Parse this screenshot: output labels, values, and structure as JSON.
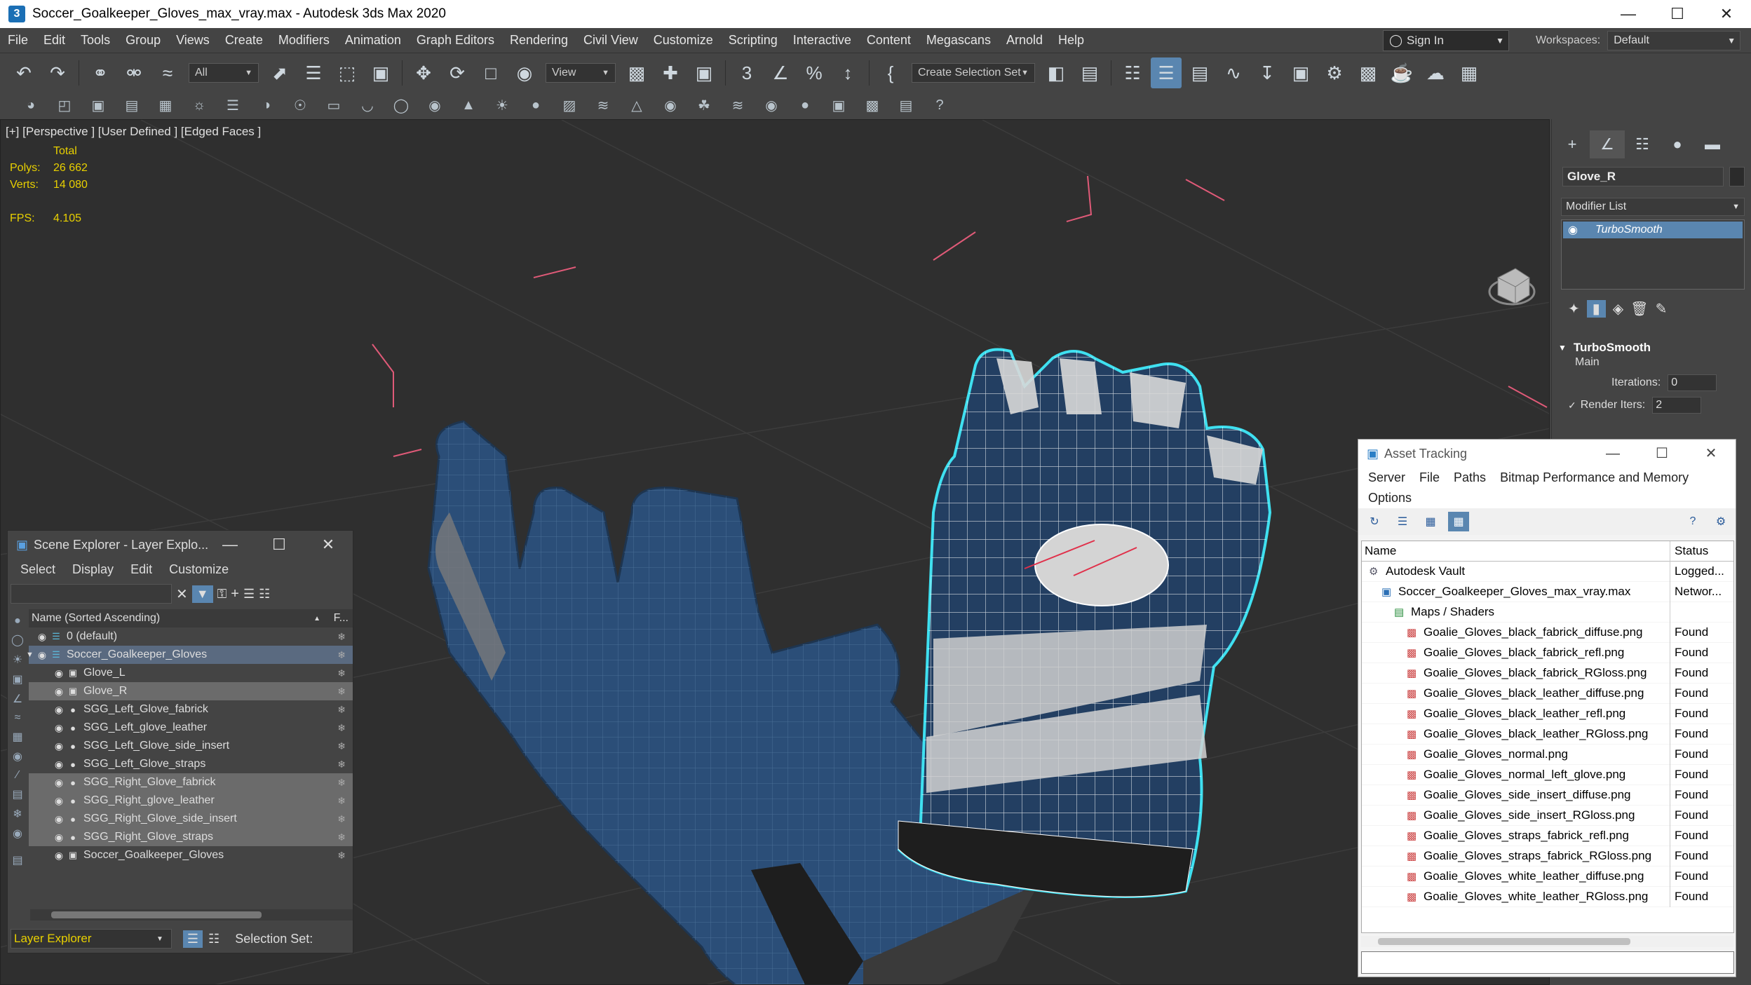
{
  "window": {
    "title": "Soccer_Goalkeeper_Gloves_max_vray.max - Autodesk 3ds Max 2020",
    "app_icon": "3"
  },
  "menu": [
    "File",
    "Edit",
    "Tools",
    "Group",
    "Views",
    "Create",
    "Modifiers",
    "Animation",
    "Graph Editors",
    "Rendering",
    "Civil View",
    "Customize",
    "Scripting",
    "Interactive",
    "Content",
    "Megascans",
    "Arnold",
    "Help"
  ],
  "signin": {
    "label": "Sign In"
  },
  "workspaces": {
    "label": "Workspaces:",
    "value": "Default"
  },
  "toolbar": {
    "filter_select": "All",
    "ref_coord": "View",
    "selection_set": "Create Selection Set"
  },
  "viewport": {
    "label": "[+] [Perspective ] [User Defined ] [Edged Faces ]",
    "stats_header": "Total",
    "polys_label": "Polys:",
    "polys": "26 662",
    "verts_label": "Verts:",
    "verts": "14 080",
    "fps_label": "FPS:",
    "fps": "4.105"
  },
  "command_panel": {
    "object_name": "Glove_R",
    "modifier_list": "Modifier List",
    "modifier_item": "TurboSmooth",
    "rollout_title": "TurboSmooth",
    "group": "Main",
    "iterations_label": "Iterations:",
    "iterations": "0",
    "render_iters_label": "Render Iters:",
    "render_iters": "2",
    "render_iters_checked": true
  },
  "scene_explorer": {
    "title": "Scene Explorer - Layer Explo...",
    "menu": [
      "Select",
      "Display",
      "Edit",
      "Customize"
    ],
    "col_name": "Name (Sorted Ascending)",
    "col_frozen": "F...",
    "rows": [
      {
        "label": "0 (default)",
        "level": 1,
        "type": "layer",
        "state": ""
      },
      {
        "label": "Soccer_Goalkeeper_Gloves",
        "level": 1,
        "type": "layer",
        "state": "hl"
      },
      {
        "label": "Glove_L",
        "level": 2,
        "type": "obj",
        "state": ""
      },
      {
        "label": "Glove_R",
        "level": 2,
        "type": "obj",
        "state": "sel"
      },
      {
        "label": "SGG_Left_Glove_fabrick",
        "level": 2,
        "type": "mat",
        "state": ""
      },
      {
        "label": "SGG_Left_glove_leather",
        "level": 2,
        "type": "mat",
        "state": ""
      },
      {
        "label": "SGG_Left_Glove_side_insert",
        "level": 2,
        "type": "mat",
        "state": ""
      },
      {
        "label": "SGG_Left_Glove_straps",
        "level": 2,
        "type": "mat",
        "state": ""
      },
      {
        "label": "SGG_Right_Glove_fabrick",
        "level": 2,
        "type": "mat",
        "state": "sel"
      },
      {
        "label": "SGG_Right_glove_leather",
        "level": 2,
        "type": "mat",
        "state": "sel"
      },
      {
        "label": "SGG_Right_Glove_side_insert",
        "level": 2,
        "type": "mat",
        "state": "sel"
      },
      {
        "label": "SGG_Right_Glove_straps",
        "level": 2,
        "type": "mat",
        "state": "sel"
      },
      {
        "label": "Soccer_Goalkeeper_Gloves",
        "level": 2,
        "type": "obj",
        "state": ""
      }
    ],
    "layer_dropdown": "Layer Explorer",
    "selection_set_label": "Selection Set:"
  },
  "asset_tracking": {
    "title": "Asset Tracking",
    "menu": [
      "Server",
      "File",
      "Paths",
      "Bitmap Performance and Memory",
      "Options"
    ],
    "col_name": "Name",
    "col_status": "Status",
    "rows": [
      {
        "name": "Autodesk Vault",
        "status": "Logged...",
        "indent": 0,
        "icon": "vault"
      },
      {
        "name": "Soccer_Goalkeeper_Gloves_max_vray.max",
        "status": "Networ...",
        "indent": 1,
        "icon": "max"
      },
      {
        "name": "Maps / Shaders",
        "status": "",
        "indent": 2,
        "icon": "folder"
      },
      {
        "name": "Goalie_Gloves_black_fabrick_diffuse.png",
        "status": "Found",
        "indent": 3,
        "icon": "file"
      },
      {
        "name": "Goalie_Gloves_black_fabrick_refl.png",
        "status": "Found",
        "indent": 3,
        "icon": "file"
      },
      {
        "name": "Goalie_Gloves_black_fabrick_RGloss.png",
        "status": "Found",
        "indent": 3,
        "icon": "file"
      },
      {
        "name": "Goalie_Gloves_black_leather_diffuse.png",
        "status": "Found",
        "indent": 3,
        "icon": "file"
      },
      {
        "name": "Goalie_Gloves_black_leather_refl.png",
        "status": "Found",
        "indent": 3,
        "icon": "file"
      },
      {
        "name": "Goalie_Gloves_black_leather_RGloss.png",
        "status": "Found",
        "indent": 3,
        "icon": "file"
      },
      {
        "name": "Goalie_Gloves_normal.png",
        "status": "Found",
        "indent": 3,
        "icon": "file"
      },
      {
        "name": "Goalie_Gloves_normal_left_glove.png",
        "status": "Found",
        "indent": 3,
        "icon": "file"
      },
      {
        "name": "Goalie_Gloves_side_insert_diffuse.png",
        "status": "Found",
        "indent": 3,
        "icon": "file"
      },
      {
        "name": "Goalie_Gloves_side_insert_RGloss.png",
        "status": "Found",
        "indent": 3,
        "icon": "file"
      },
      {
        "name": "Goalie_Gloves_straps_fabrick_refl.png",
        "status": "Found",
        "indent": 3,
        "icon": "file"
      },
      {
        "name": "Goalie_Gloves_straps_fabrick_RGloss.png",
        "status": "Found",
        "indent": 3,
        "icon": "file"
      },
      {
        "name": "Goalie_Gloves_white_leather_diffuse.png",
        "status": "Found",
        "indent": 3,
        "icon": "file"
      },
      {
        "name": "Goalie_Gloves_white_leather_RGloss.png",
        "status": "Found",
        "indent": 3,
        "icon": "file"
      }
    ]
  },
  "colors": {
    "accent": "#5a86b0",
    "stats": "#e8d000",
    "selection_outline": "#3fe0f0",
    "glove_blue": "#23466a"
  }
}
